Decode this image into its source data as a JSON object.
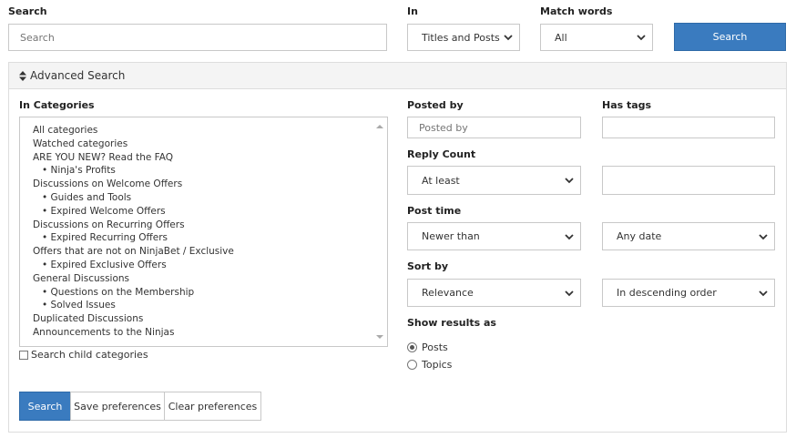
{
  "search": {
    "label": "Search",
    "placeholder": "Search",
    "in_label": "In",
    "in_value": "Titles and Posts",
    "match_label": "Match words",
    "match_value": "All",
    "button": "Search"
  },
  "advanced": {
    "title": "Advanced Search",
    "categories_label": "In Categories",
    "categories": [
      {
        "label": "All categories",
        "level": 0
      },
      {
        "label": "Watched categories",
        "level": 0
      },
      {
        "label": "ARE YOU NEW? Read the FAQ",
        "level": 0
      },
      {
        "label": "• Ninja's Profits",
        "level": 1
      },
      {
        "label": "Discussions on Welcome Offers",
        "level": 0
      },
      {
        "label": "• Guides and Tools",
        "level": 1
      },
      {
        "label": "• Expired Welcome Offers",
        "level": 1
      },
      {
        "label": "Discussions on Recurring Offers",
        "level": 0
      },
      {
        "label": "• Expired Recurring Offers",
        "level": 1
      },
      {
        "label": "Offers that are not on NinjaBet / Exclusive",
        "level": 0
      },
      {
        "label": "• Expired Exclusive Offers",
        "level": 1
      },
      {
        "label": "General Discussions",
        "level": 0
      },
      {
        "label": "• Questions on the Membership",
        "level": 1
      },
      {
        "label": "• Solved Issues",
        "level": 1
      },
      {
        "label": "Duplicated Discussions",
        "level": 0
      },
      {
        "label": "Announcements to the Ninjas",
        "level": 0
      }
    ],
    "child_label": "Search child categories",
    "posted_by_label": "Posted by",
    "posted_by_placeholder": "Posted by",
    "has_tags_label": "Has tags",
    "reply_count_label": "Reply Count",
    "reply_count_value": "At least",
    "post_time_label": "Post time",
    "post_time_value": "Newer than",
    "post_time_date": "Any date",
    "sort_by_label": "Sort by",
    "sort_by_value": "Relevance",
    "sort_order_value": "In descending order",
    "show_results_label": "Show results as",
    "results_options": [
      "Posts",
      "Topics"
    ],
    "results_selected": "Posts"
  },
  "actions": {
    "search": "Search",
    "save": "Save preferences",
    "clear": "Clear preferences"
  },
  "colors": {
    "primary": "#3a7bbf",
    "panel_bg": "#f4f4f4",
    "border": "#c8c8c8"
  }
}
